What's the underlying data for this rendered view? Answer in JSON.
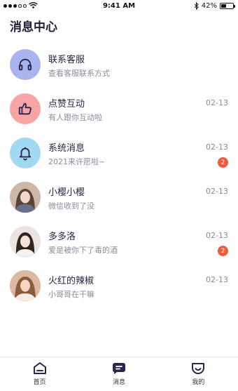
{
  "status_bar": {
    "time": "9:41 AM",
    "battery": "42%",
    "battery_level": 0.42
  },
  "page_title": "消息中心",
  "rows": [
    {
      "title": "联系客服",
      "subtitle": "查看客服联系方式",
      "date": "",
      "badge": "",
      "icon": "headphones-icon",
      "color": "#aab5f0"
    },
    {
      "title": "点赞互动",
      "subtitle": "有人跟你互动啦",
      "date": "02-13",
      "badge": "",
      "icon": "thumbs-up-icon",
      "color": "#f7a4a4"
    },
    {
      "title": "系统消息",
      "subtitle": "2021来许愿啦~",
      "date": "02-13",
      "badge": "2",
      "icon": "bell-icon",
      "color": "#a3d8f2"
    },
    {
      "title": "小樱小樱",
      "subtitle": "微信收到了没",
      "date": "02-13",
      "badge": "",
      "icon": "avatar-photo",
      "color": "#d9c3b5"
    },
    {
      "title": "多多洛",
      "subtitle": "爱是被你下了毒的酒",
      "date": "02-13",
      "badge": "2",
      "icon": "avatar-photo",
      "color": "#e9ded6"
    },
    {
      "title": "火红的辣椒",
      "subtitle": "小哥哥在干嘛",
      "date": "02-13",
      "badge": "",
      "icon": "avatar-photo",
      "color": "#d7b39b"
    }
  ],
  "tabs": [
    {
      "label": "首页",
      "icon": "home-icon"
    },
    {
      "label": "消息",
      "icon": "message-icon",
      "active": true
    },
    {
      "label": "我的",
      "icon": "profile-icon"
    }
  ],
  "colors": {
    "accent": "#2b2350",
    "badge": "#f25a3c"
  }
}
